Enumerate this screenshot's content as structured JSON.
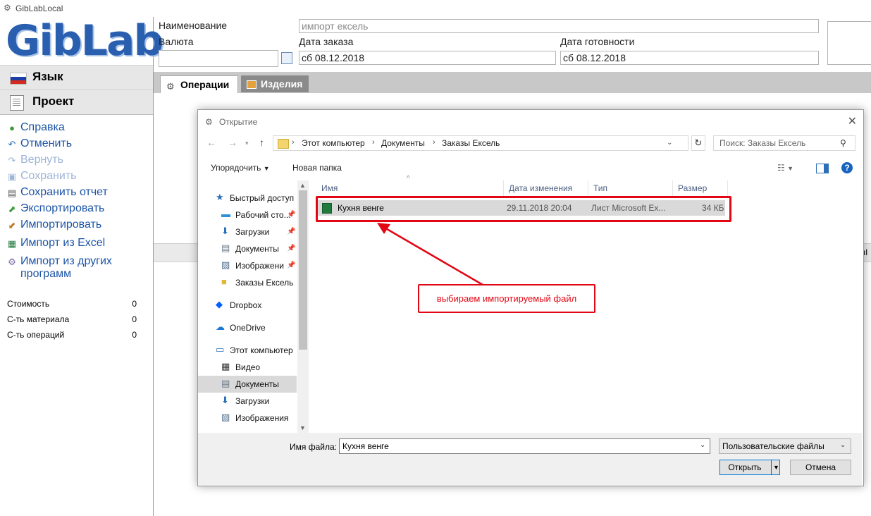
{
  "window": {
    "title": "GibLabLocal"
  },
  "logo": {
    "text": "GibLab",
    "color": "#2a5fb0"
  },
  "nav": {
    "language": "Язык",
    "project": "Проект"
  },
  "menu": [
    {
      "label": "Справка",
      "icon": "help-icon",
      "enabled": true
    },
    {
      "label": "Отменить",
      "icon": "undo-icon",
      "enabled": true
    },
    {
      "label": "Вернуть",
      "icon": "redo-icon",
      "enabled": false
    },
    {
      "label": "Сохранить",
      "icon": "save-icon",
      "enabled": false
    },
    {
      "label": "Сохранить отчет",
      "icon": "print-icon",
      "enabled": true
    },
    {
      "label": "Экспортировать",
      "icon": "export-icon",
      "enabled": true
    },
    {
      "label": "Импортировать",
      "icon": "import-icon",
      "enabled": true
    },
    {
      "label": "Импорт из Excel",
      "icon": "excel-icon",
      "enabled": true
    },
    {
      "label": "Импорт из других\nпрограмм",
      "icon": "import-other-icon",
      "enabled": true
    }
  ],
  "stats": [
    {
      "label": "Стоимость",
      "value": "0"
    },
    {
      "label": "С-ть материала",
      "value": "0"
    },
    {
      "label": "С-ть операций",
      "value": "0"
    }
  ],
  "form": {
    "name_label": "Наименование",
    "name_value": "импорт ексель",
    "currency_label": "Валюта",
    "currency_value": "",
    "order_date_label": "Дата заказа",
    "order_date_value": "сб 08.12.2018",
    "ready_date_label": "Дата готовности",
    "ready_date_value": "сб 08.12.2018"
  },
  "tabs": [
    {
      "label": "Операции",
      "active": true
    },
    {
      "label": "Изделия",
      "active": false
    }
  ],
  "dialog": {
    "title": "Открытие",
    "breadcrumbs": [
      "Этот компьютер",
      "Документы",
      "Заказы Ексель"
    ],
    "search_placeholder": "Поиск: Заказы Ексель",
    "toolbar": {
      "organize": "Упорядочить",
      "new_folder": "Новая папка"
    },
    "tree": [
      {
        "label": "Быстрый доступ",
        "icon": "star-icon",
        "pinned": false
      },
      {
        "label": "Рабочий сто...",
        "icon": "desktop-icon",
        "pinned": true
      },
      {
        "label": "Загрузки",
        "icon": "download-icon",
        "pinned": true
      },
      {
        "label": "Документы",
        "icon": "document-icon",
        "pinned": true
      },
      {
        "label": "Изображени",
        "icon": "image-icon",
        "pinned": true
      },
      {
        "label": "Заказы Ексель",
        "icon": "folder-icon",
        "pinned": false
      },
      {
        "label": "Dropbox",
        "icon": "dropbox-icon",
        "pinned": false
      },
      {
        "label": "OneDrive",
        "icon": "cloud-icon",
        "pinned": false
      },
      {
        "label": "Этот компьютер",
        "icon": "computer-icon",
        "pinned": false
      },
      {
        "label": "Видео",
        "icon": "video-icon",
        "pinned": false
      },
      {
        "label": "Документы",
        "icon": "document-icon",
        "pinned": false
      },
      {
        "label": "Загрузки",
        "icon": "download-icon",
        "pinned": false
      },
      {
        "label": "Изображения",
        "icon": "image-icon",
        "pinned": false
      }
    ],
    "columns": [
      "Имя",
      "Дата изменения",
      "Тип",
      "Размер"
    ],
    "files": [
      {
        "name": "Кухня венге",
        "modified": "29.11.2018 20:04",
        "type": "Лист Microsoft Ex...",
        "size": "34 КБ"
      }
    ],
    "filename_label": "Имя файла:",
    "filename_value": "Кухня венге",
    "filetype_value": "Пользовательские файлы",
    "open_label": "Открыть",
    "cancel_label": "Отмена"
  },
  "annotation": {
    "text": "выбираем импортируемый файл",
    "color": "#e30613"
  }
}
